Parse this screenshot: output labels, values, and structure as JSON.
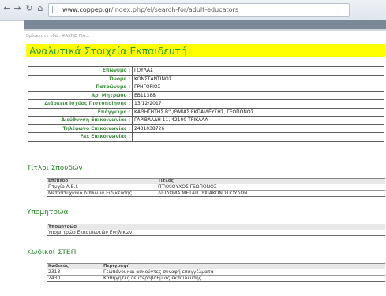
{
  "browser": {
    "url_host": "www.coppep.gr",
    "url_path": "/index.php/el/search-for/adult-educators"
  },
  "breadcrumb": "Βρίσκεστε εδώ: ΨΑΧΝΩ ΓΙΑ...",
  "page_title": "Αναλυτικά Στοιχεία Εκπαιδευτή",
  "details": [
    {
      "label": "Επώνυμο :",
      "value": "ΓΟΥΛΑΣ"
    },
    {
      "label": "Όνομα :",
      "value": "ΚΩΝΣΤΑΝΤΙΝΟΣ"
    },
    {
      "label": "Πατρώνυμο :",
      "value": "ΓΡΗΓΟΡΙΟΣ"
    },
    {
      "label": "Αρ. Μητρώου :",
      "value": "ΕΒ11388"
    },
    {
      "label": "Διάρκεια Ισχύος Πιστοποίησης :",
      "value": "13/12/2017"
    },
    {
      "label": "Επάγγελμα :",
      "value": "ΚΑΘΗΓΗΤΗΣ Β'' /ΘΜΙΑΣ ΕΚΠΑΙΔΕΥΣΗΣ, ΓΕΩΠΟΝΟΣ"
    },
    {
      "label": "Διεύθυνση Επικοινωνίας :",
      "value": "ΓΑΡΙΒΑΛΔΗ 11, 42100 ΤΡΙΚΑΛΑ"
    },
    {
      "label": "Τηλέφωνο Επικοινωνίας :",
      "value": "2431038726"
    },
    {
      "label": "Fax Επικοινωνίας :",
      "value": ""
    }
  ],
  "studies": {
    "heading": "Τίτλοι Σπουδών",
    "columns": [
      "Επίπεδο",
      "Τίτλος"
    ],
    "rows": [
      [
        "Πτυχίο Α.Ε.Ι.",
        "ΠΤΥΧΙΟΥΧΟΣ ΓΕΩΠΟΝΟΣ"
      ],
      [
        "Μεταπτυχιακό Δίπλωμα Ειδίκευσης",
        "ΔΙΠΛΩΜΑ ΜΕΤΑΠΤΥΧΙΑΚΩΝ ΣΠΟΥΔΩΝ"
      ]
    ]
  },
  "registries": {
    "heading": "Υπομητρώα",
    "columns": [
      "Υπομητρώο"
    ],
    "rows": [
      [
        "Υπομητρώο Εκπαιδευτών Ενηλίκων"
      ]
    ]
  },
  "step_codes": {
    "heading": "Κωδικοί ΣΤΕΠ",
    "columns": [
      "Κωδικός",
      "Περιγραφή"
    ],
    "rows": [
      [
        "2313",
        "Γεωπόνοι και ασκούντες συναφή επαγγέλματα"
      ],
      [
        "2430",
        "Καθηγητές δευτεροβάθμιας εκπαίδευσης"
      ]
    ]
  }
}
